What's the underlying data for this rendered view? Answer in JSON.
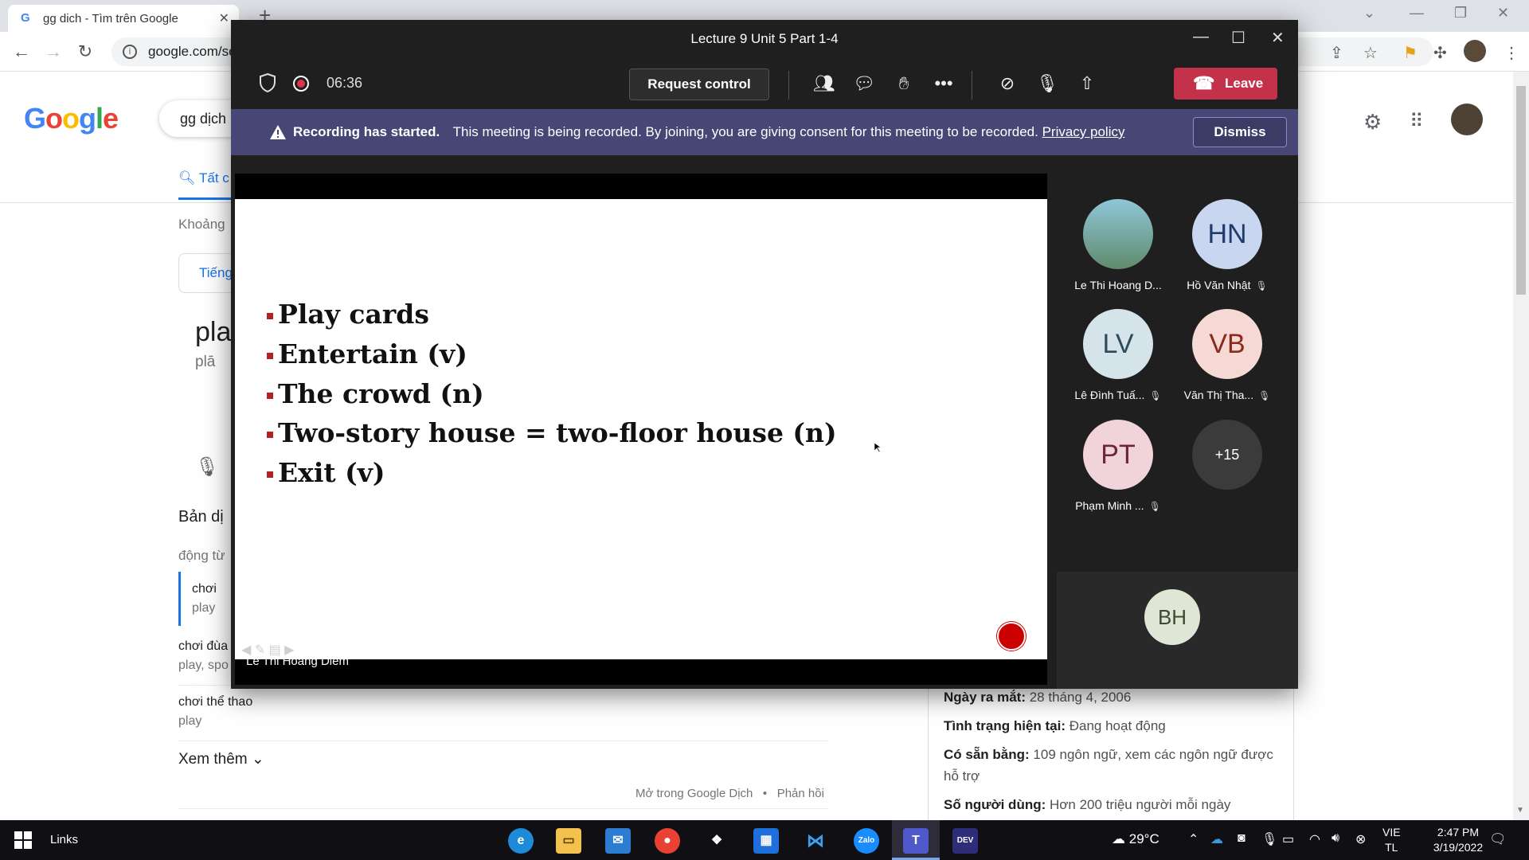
{
  "browser": {
    "tab_title": "gg dich - Tìm trên Google",
    "url": "google.com/se",
    "new_tab": "+",
    "close": "✕"
  },
  "google": {
    "query": "gg dịch",
    "tab_all": "Tất c",
    "results_count": "Khoảng",
    "lang_chip": "Tiếng",
    "word": "pla",
    "pron": "plā",
    "translation_label": "Bản dị",
    "pos": "động từ",
    "translations": [
      {
        "vi": "chơi",
        "en": "play"
      },
      {
        "vi": "chơi đùa",
        "en": "play, spo"
      },
      {
        "vi": "chơi thể thao",
        "en": "play"
      }
    ],
    "see_more": "Xem thêm",
    "open_gt": "Mở trong Google Dịch",
    "bullet_sep": "•",
    "feedback": "Phản hồi",
    "kp": [
      {
        "label": "Ngày ra mắt:",
        "value": "28 tháng 4, 2006"
      },
      {
        "label": "Tình trạng hiện tại:",
        "value": "Đang hoạt động"
      },
      {
        "label": "Có sẵn bằng:",
        "value": "109 ngôn ngữ, xem các ngôn ngữ được hỗ trợ"
      },
      {
        "label": "Số người dùng:",
        "value": "Hơn 200 triệu người mỗi ngày"
      }
    ]
  },
  "teams": {
    "title": "Lecture 9 Unit 5 Part 1-4",
    "timer": "06:36",
    "request_control": "Request control",
    "leave": "Leave",
    "banner_bold": "Recording has started.",
    "banner_text": "This meeting is being recorded. By joining, you are giving consent for this meeting to be recorded.",
    "privacy_link": "Privacy policy",
    "dismiss": "Dismiss",
    "presenter": "Le Thi Hoang Diem",
    "slide_bullets": [
      "Play cards",
      "Entertain (v)",
      "The crowd (n)",
      "Two-story house = two-floor house (n)",
      "Exit (v)"
    ],
    "participants": [
      {
        "initials": "",
        "name": "Le Thi Hoang D...",
        "muted": false,
        "bg": "#8ab4c8",
        "fg": "#fff"
      },
      {
        "initials": "HN",
        "name": "Hồ Văn Nhật",
        "muted": true,
        "bg": "#c9d6ef",
        "fg": "#1f3a6b"
      },
      {
        "initials": "LV",
        "name": "Lê Đình Tuấ...",
        "muted": true,
        "bg": "#d5e3ea",
        "fg": "#2d4b5a"
      },
      {
        "initials": "VB",
        "name": "Văn Thị Tha...",
        "muted": true,
        "bg": "#f6d9d4",
        "fg": "#8a2a1f"
      },
      {
        "initials": "PT",
        "name": "Phạm Minh ...",
        "muted": true,
        "bg": "#f1d3da",
        "fg": "#6e2538"
      },
      {
        "initials": "+15",
        "name": "",
        "muted": false,
        "bg": "#3b3b3b",
        "fg": "#fff"
      }
    ],
    "bh": "BH"
  },
  "taskbar": {
    "links": "Links",
    "weather": "29°C",
    "lang_top": "VIE",
    "lang_bottom": "TL",
    "time": "2:47 PM",
    "date": "3/19/2022"
  }
}
